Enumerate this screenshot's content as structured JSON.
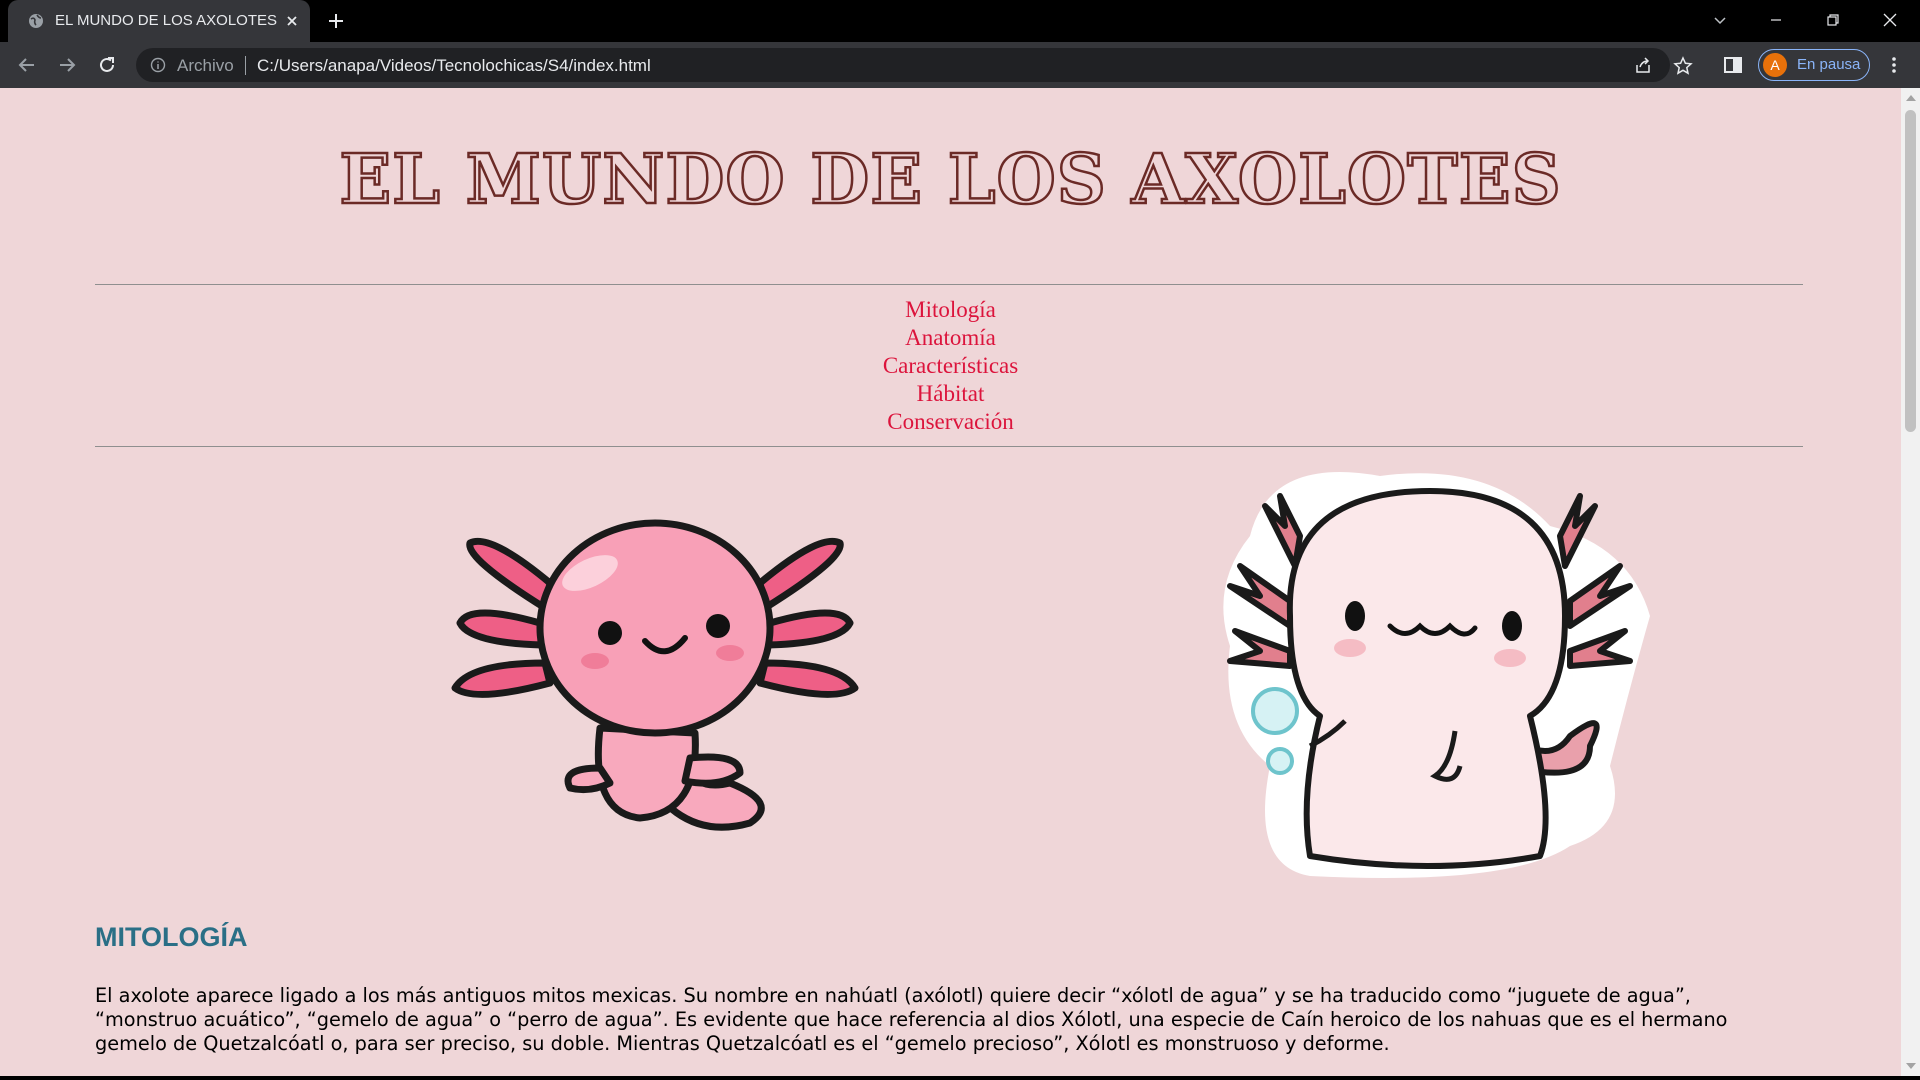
{
  "browser": {
    "tab_title": "EL MUNDO DE LOS AXOLOTES",
    "scheme_label": "Archivo",
    "url": "C:/Users/anapa/Videos/Tecnolochicas/S4/index.html",
    "profile_initial": "A",
    "profile_status": "En pausa",
    "icons": [
      "globe-icon",
      "close-icon",
      "plus-icon",
      "chevron-down-icon",
      "minimize-icon",
      "restore-icon",
      "close-window-icon",
      "back-icon",
      "forward-icon",
      "reload-icon",
      "info-icon",
      "share-icon",
      "star-icon",
      "side-panel-icon",
      "kebab-menu-icon"
    ]
  },
  "page": {
    "title": "EL MUNDO DE LOS AXOLOTES",
    "nav": [
      "Mitología",
      "Anatomía",
      "Características",
      "Hábitat",
      "Conservación"
    ],
    "section": {
      "heading": "MITOLOGÍA",
      "text": "El axolote aparece ligado a los más antiguos mitos mexicas. Su nombre en nahúatl (axólotl) quiere decir “xólotl de agua” y se ha traducido como “juguete de agua”, “monstruo acuático”, “gemelo de agua” o “perro de agua”. Es evidente que hace referencia al dios Xólotl, una especie de Caín heroico de los nahuas que es el hermano gemelo de Quetzalcóatl o, para ser preciso, su doble. Mientras Quetzalcóatl es el “gemelo precioso”, Xólotl es monstruoso y deforme."
    },
    "colors": {
      "background": "#efd6d8",
      "title_outline": "#6b2a26",
      "nav_link": "#dc143c",
      "heading": "#2a6f86"
    }
  }
}
